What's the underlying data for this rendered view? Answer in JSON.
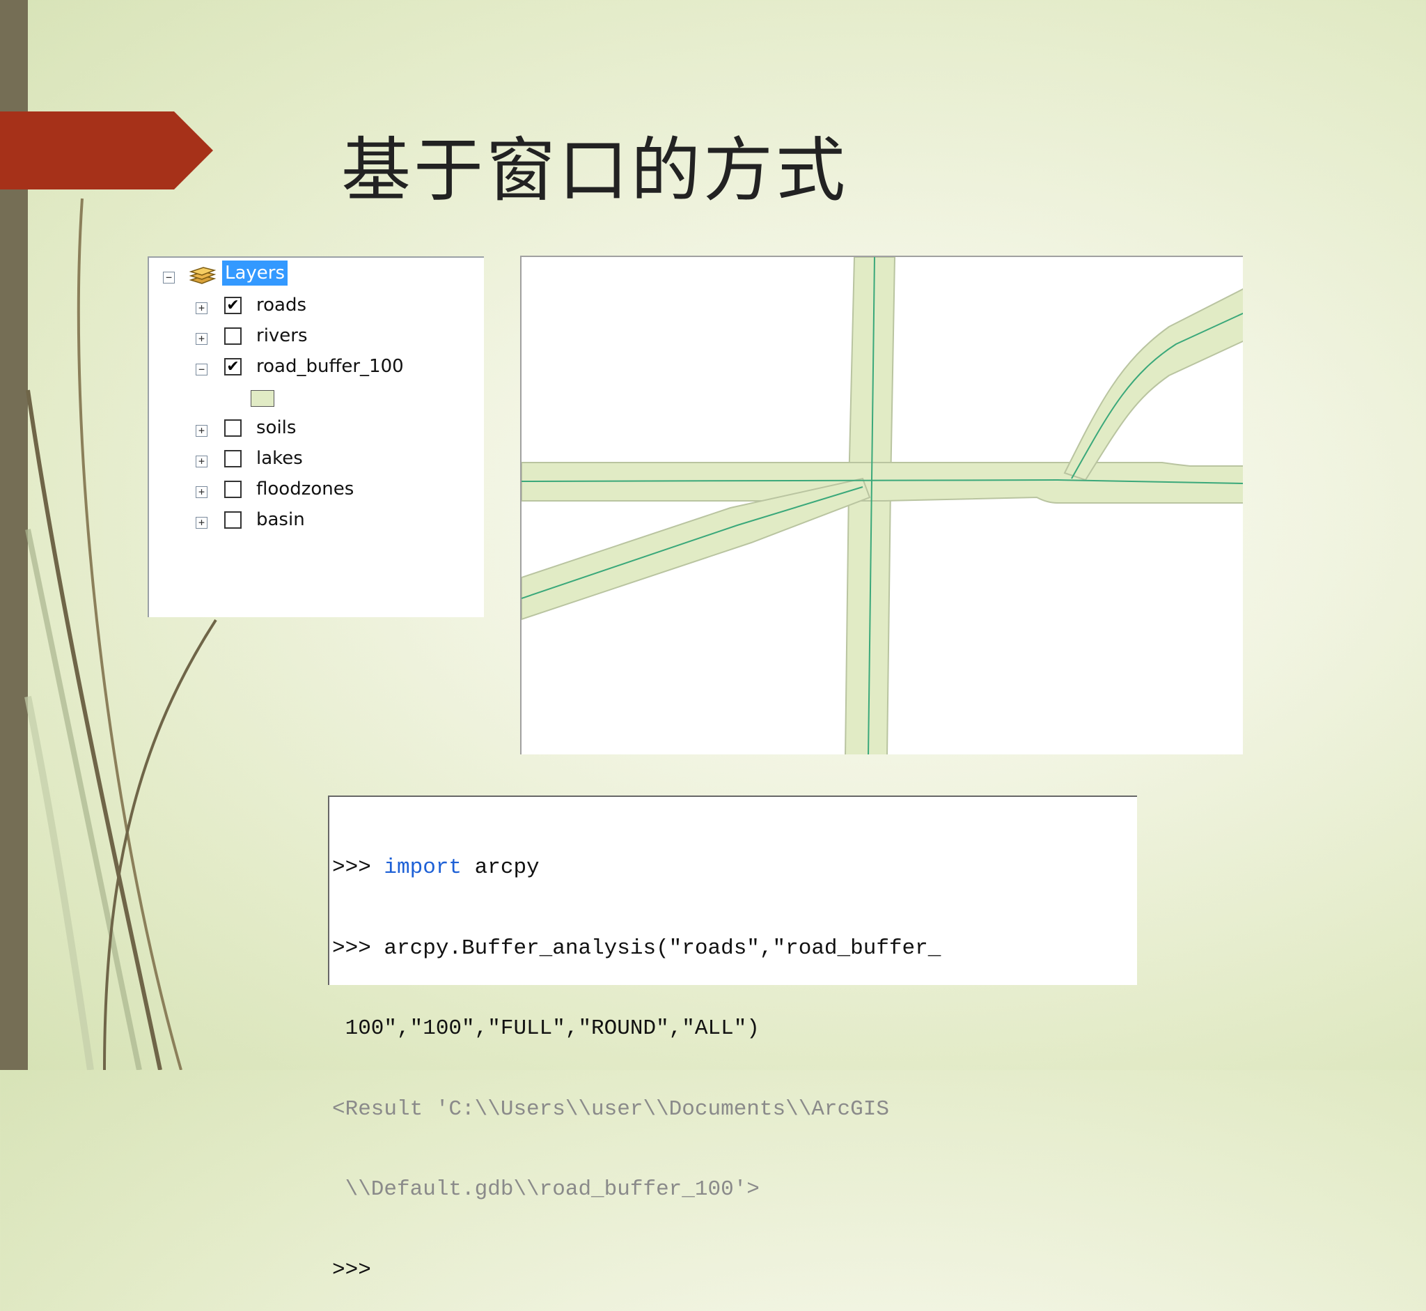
{
  "slide": {
    "title": "基于窗口的方式"
  },
  "toc": {
    "root_label": "Layers",
    "root_expanded": true,
    "layers": [
      {
        "name": "roads",
        "checked": true,
        "expanded": false
      },
      {
        "name": "rivers",
        "checked": false,
        "expanded": false
      },
      {
        "name": "road_buffer_100",
        "checked": true,
        "expanded": true,
        "symbol_color": "#e1ebc5"
      },
      {
        "name": "soils",
        "checked": false,
        "expanded": false
      },
      {
        "name": "lakes",
        "checked": false,
        "expanded": false
      },
      {
        "name": "floodzones",
        "checked": false,
        "expanded": false
      },
      {
        "name": "basin",
        "checked": false,
        "expanded": false
      }
    ]
  },
  "console": {
    "prompt": ">>>",
    "line1_keyword": "import",
    "line1_rest": " arcpy",
    "line2": " arcpy.Buffer_analysis(\"roads\",\"road_buffer_",
    "line3": " 100\",\"100\",\"FULL\",\"ROUND\",\"ALL\")",
    "line4": "<Result 'C:\\\\Users\\\\user\\\\Documents\\\\ArcGIS",
    "line5": " \\\\Default.gdb\\\\road_buffer_100'>"
  },
  "colors": {
    "accent_ribbon": "#a63119",
    "side_bar": "#756e55",
    "buffer_fill": "#e1ebc5",
    "road_line": "#3aa87a",
    "selection": "#3399ff",
    "keyword": "#1d60d6"
  },
  "icons": {
    "layers": "layers-stack-icon",
    "expand": "plus-box-icon",
    "collapse": "minus-box-icon",
    "check": "checkmark-icon"
  }
}
